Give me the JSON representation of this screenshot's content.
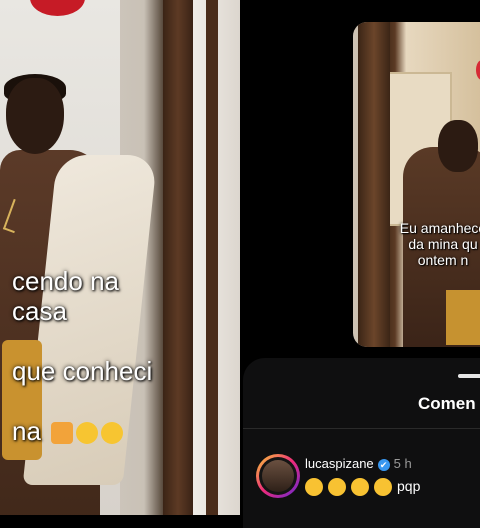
{
  "left_panel": {
    "caption_lines": [
      "cendo na casa",
      "que conheci",
      "na"
    ]
  },
  "right_panel": {
    "video_caption_lines": [
      "Eu amanheco",
      "da mina qu",
      "ontem n"
    ],
    "comments_sheet": {
      "title": "Comen",
      "comment": {
        "username": "lucaspizane",
        "verified": "✔",
        "time": "5 h",
        "text": "pqp"
      }
    }
  },
  "colors": {
    "verified_blue": "#3897f0",
    "sheet_bg": "#0f0f10",
    "balloon_red": "#c61b26"
  }
}
